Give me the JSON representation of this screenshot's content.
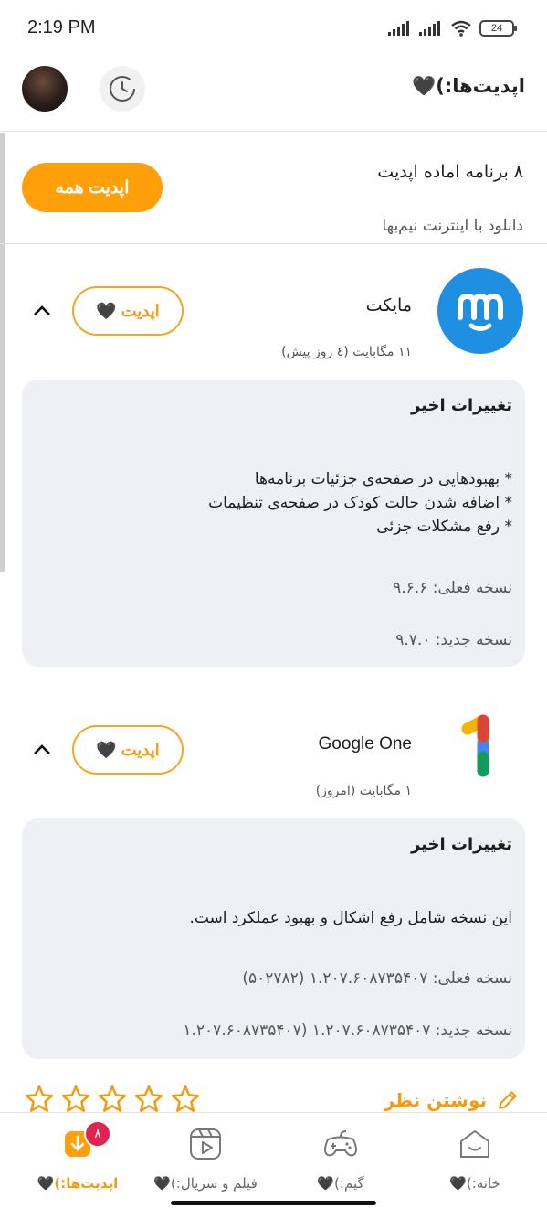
{
  "status_bar": {
    "time": "2:19 PM",
    "battery": "24"
  },
  "header": {
    "title": "اپدیت‌ها:)🖤"
  },
  "summary": {
    "update_all_label": "اپدیت همه",
    "count_text": "۸ برنامه اماده اپدیت",
    "subtitle": "دانلود با اینترنت نیم‌بها"
  },
  "apps": [
    {
      "name": "مایکت",
      "meta": "۱۱ مگابایت (٤ روز پیش)",
      "update_label": "اپدیت 🖤",
      "changes_title": "تغییرات اخیر",
      "changes_body": "* بهبودهایی در صفحه‌ی جزئیات برنامه‌ها\n* اضافه شدن حالت کودک در صفحه‌ی تنظیمات\n* رفع مشکلات جزئی",
      "current_version": "نسخه فعلی: ۹.۶.۶",
      "new_version": "نسخه جدید: ۹.۷.۰"
    },
    {
      "name": "Google One",
      "meta": "۱ مگابایت (امروز)",
      "update_label": "اپدیت 🖤",
      "changes_title": "تغییرات اخیر",
      "changes_body": "این نسخه شامل رفع اشکال و بهبود عملکرد است.",
      "current_version": "نسخه فعلی: ۱.۲۰۷.۶۰۸۷۳۵۴۰۷ (۵۰۲۷۸۲)",
      "new_version": "نسخه جدید: ۱.۲۰۷.۶۰۸۷۳۵۴۰۷ (۱.۲۰۷.۶۰۸۷۳۵۴۰۷"
    }
  ],
  "review": {
    "label": "نوشتن نظر"
  },
  "bottom_nav": {
    "updates_label": "اپدیت‌ها:)🖤",
    "updates_badge": "۸",
    "movies_label": "فیلم و سریال:)🖤",
    "games_label": "گیم:)🖤",
    "home_label": "خانه:)🖤"
  },
  "colors": {
    "accent": "#ff9f0a",
    "badge": "#e0244f",
    "panel": "#eef0f3"
  }
}
